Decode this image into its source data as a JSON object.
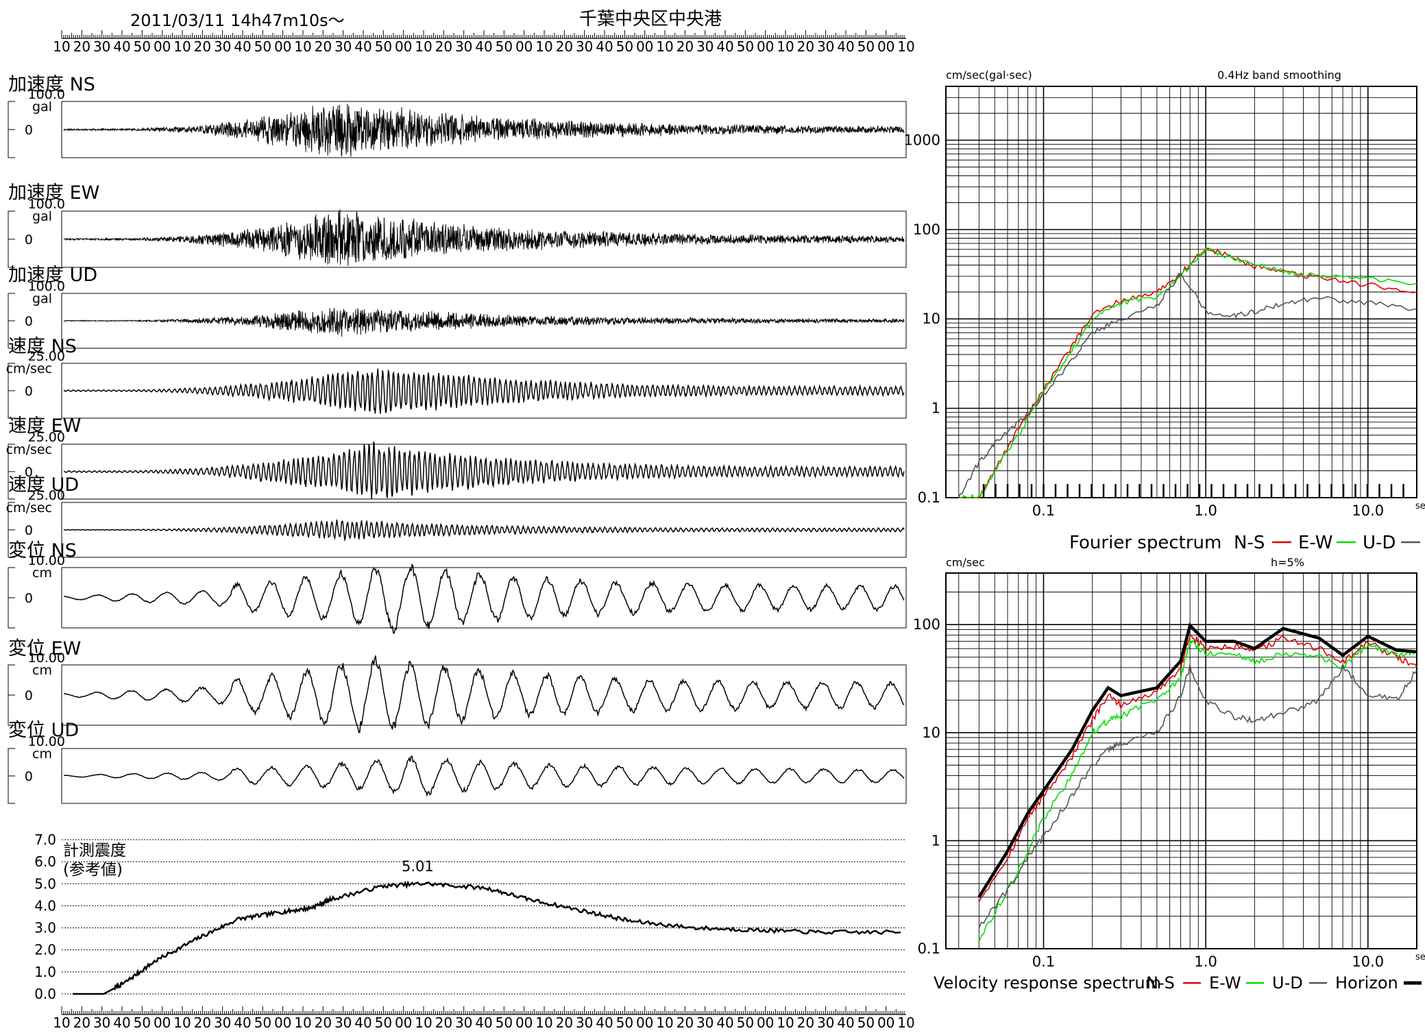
{
  "header": {
    "datetime": "2011/03/11  14h47m10s〜",
    "station": "千葉中央区中央港"
  },
  "time_axis": {
    "tick_labels": [
      "10",
      "20",
      "30",
      "40",
      "50",
      "00",
      "10",
      "20",
      "30",
      "40",
      "50",
      "00",
      "10",
      "20",
      "30",
      "40",
      "50",
      "00",
      "10",
      "20",
      "30",
      "40",
      "50",
      "00",
      "10",
      "20",
      "30",
      "40",
      "50",
      "00",
      "10",
      "20",
      "30",
      "40",
      "50",
      "00",
      "10",
      "20",
      "30",
      "40",
      "50",
      "00",
      "10"
    ],
    "small_marks": [
      "h",
      "m",
      "s"
    ]
  },
  "traces": [
    {
      "label": "加速度 NS",
      "scale": "100.0",
      "unit": "gal",
      "zero": "0",
      "kind": "acc",
      "amp": 1.0,
      "env_peak": 0.33,
      "seed": 11
    },
    {
      "label": "加速度 EW",
      "scale": "100.0",
      "unit": "gal",
      "zero": "0",
      "kind": "acc",
      "amp": 1.0,
      "env_peak": 0.33,
      "seed": 23
    },
    {
      "label": "加速度 UD",
      "scale": "100.0",
      "unit": "gal",
      "zero": "0",
      "kind": "acc",
      "amp": 0.55,
      "env_peak": 0.33,
      "seed": 37
    },
    {
      "label": "速度 NS",
      "scale": "25.00",
      "unit": "cm/sec",
      "zero": "0",
      "kind": "vel",
      "amp": 0.85,
      "env_peak": 0.38,
      "seed": 41
    },
    {
      "label": "速度 EW",
      "scale": "25.00",
      "unit": "cm/sec",
      "zero": "0",
      "kind": "vel",
      "amp": 0.95,
      "env_peak": 0.37,
      "seed": 53
    },
    {
      "label": "速度 UD",
      "scale": "25.00",
      "unit": "cm/sec",
      "zero": "0",
      "kind": "vel",
      "amp": 0.35,
      "env_peak": 0.33,
      "seed": 61
    },
    {
      "label": "変位 NS",
      "scale": "10.00",
      "unit": "cm",
      "zero": "0",
      "kind": "disp",
      "amp": 0.9,
      "env_peak": 0.4,
      "seed": 71
    },
    {
      "label": "変位 EW",
      "scale": "10.00",
      "unit": "cm",
      "zero": "0",
      "kind": "disp",
      "amp": 1.0,
      "env_peak": 0.37,
      "seed": 83
    },
    {
      "label": "変位 UD",
      "scale": "10.00",
      "unit": "cm",
      "zero": "0",
      "kind": "disp",
      "amp": 0.55,
      "env_peak": 0.42,
      "seed": 97
    }
  ],
  "intensity": {
    "title_line1": "計測震度",
    "title_line2": "(参考値)",
    "max_label": "5.01",
    "yticks": [
      "7.0",
      "6.0",
      "5.0",
      "4.0",
      "3.0",
      "2.0",
      "1.0",
      "0.0"
    ]
  },
  "fourier": {
    "unit": "cm/sec(gal·sec)",
    "note": "0.4Hz band smoothing",
    "caption": "Fourier spectrum",
    "legend": [
      {
        "name": "N-S",
        "color": "#e00000"
      },
      {
        "name": "E-W",
        "color": "#00dd00"
      },
      {
        "name": "U-D",
        "color": "#555555"
      }
    ]
  },
  "response": {
    "unit": "cm/sec",
    "note": "h=5%",
    "caption": "Velocity response spectrum",
    "legend": [
      {
        "name": "N-S",
        "color": "#e00000"
      },
      {
        "name": "E-W",
        "color": "#00dd00"
      },
      {
        "name": "U-D",
        "color": "#555555"
      },
      {
        "name": "Horizon",
        "color": "#000000"
      }
    ]
  },
  "spectrum_axes": {
    "x_ticks": [
      "0.1",
      "1.0",
      "10.0"
    ],
    "x_unit": "sec",
    "fourier_y_ticks": [
      "1000",
      "100",
      "10",
      "1",
      "0.1"
    ],
    "response_y_ticks": [
      "100",
      "10",
      "1",
      "0.1"
    ]
  },
  "chart_data": [
    {
      "type": "line",
      "title": "Fourier spectrum",
      "note": "0.4Hz band smoothing",
      "ylabel": "cm/sec(gal·sec)",
      "xlabel": "sec",
      "x_scale": "log",
      "y_scale": "log",
      "xlim": [
        0.025,
        20
      ],
      "ylim": [
        0.1,
        4000
      ],
      "x": [
        0.03,
        0.04,
        0.05,
        0.07,
        0.1,
        0.15,
        0.2,
        0.3,
        0.5,
        0.7,
        1.0,
        1.5,
        2.0,
        3.0,
        5.0,
        10.0,
        20.0
      ],
      "series": [
        {
          "name": "N-S",
          "values": [
            0.1,
            0.1,
            0.2,
            0.6,
            1.6,
            5.0,
            11.0,
            16.0,
            20.0,
            32.0,
            62.0,
            48.0,
            38.0,
            33.0,
            29.0,
            24.0,
            20.0
          ]
        },
        {
          "name": "E-W",
          "values": [
            0.1,
            0.1,
            0.2,
            0.5,
            1.5,
            4.5,
            10.0,
            15.0,
            18.0,
            30.0,
            60.0,
            48.0,
            40.0,
            34.0,
            31.0,
            28.0,
            25.0
          ]
        },
        {
          "name": "U-D",
          "values": [
            0.1,
            0.25,
            0.4,
            0.7,
            1.4,
            3.5,
            7.0,
            10.0,
            14.0,
            33.0,
            12.0,
            11.0,
            12.0,
            15.0,
            17.0,
            15.0,
            13.0
          ]
        }
      ]
    },
    {
      "type": "line",
      "title": "Velocity response spectrum",
      "note": "h=5%",
      "ylabel": "cm/sec",
      "xlabel": "sec",
      "x_scale": "log",
      "y_scale": "log",
      "xlim": [
        0.025,
        20
      ],
      "ylim": [
        0.1,
        300
      ],
      "x": [
        0.04,
        0.06,
        0.08,
        0.1,
        0.15,
        0.2,
        0.25,
        0.3,
        0.5,
        0.7,
        0.8,
        1.0,
        1.5,
        2.0,
        3.0,
        5.0,
        7.0,
        10.0,
        15.0,
        20.0
      ],
      "series": [
        {
          "name": "N-S",
          "values": [
            0.28,
            0.7,
            1.6,
            2.6,
            6.0,
            13.0,
            22.0,
            18.0,
            24.0,
            40.0,
            80.0,
            60.0,
            62.0,
            56.0,
            75.0,
            60.0,
            45.0,
            68.0,
            50.0,
            40.0
          ]
        },
        {
          "name": "E-W",
          "values": [
            0.12,
            0.35,
            0.8,
            1.6,
            4.0,
            10.0,
            13.0,
            14.0,
            21.0,
            32.0,
            70.0,
            55.0,
            52.0,
            45.0,
            55.0,
            50.0,
            40.0,
            65.0,
            52.0,
            55.0
          ]
        },
        {
          "name": "U-D",
          "values": [
            0.16,
            0.35,
            0.7,
            1.1,
            2.6,
            5.0,
            7.0,
            8.0,
            10.0,
            22.0,
            40.0,
            20.0,
            14.0,
            13.0,
            15.0,
            20.0,
            40.0,
            22.0,
            20.0,
            38.0
          ]
        },
        {
          "name": "Horizon",
          "values": [
            0.3,
            0.8,
            1.8,
            2.9,
            7.0,
            16.0,
            26.0,
            22.0,
            26.0,
            46.0,
            98.0,
            70.0,
            70.0,
            60.0,
            92.0,
            75.0,
            52.0,
            78.0,
            58.0,
            56.0
          ]
        }
      ]
    },
    {
      "type": "line",
      "title": "計測震度",
      "ylim": [
        0,
        7
      ],
      "x": [
        0,
        1.5,
        2.5,
        4,
        6,
        8,
        10,
        11.5,
        12.5,
        15,
        17,
        20,
        22,
        25,
        27,
        30,
        33,
        36,
        40
      ],
      "values": [
        0.0,
        0.0,
        0.5,
        1.5,
        2.5,
        3.4,
        3.7,
        3.9,
        4.3,
        4.9,
        5.01,
        4.8,
        4.3,
        3.7,
        3.3,
        3.0,
        2.9,
        2.8,
        2.8
      ],
      "max_label": "5.01"
    }
  ]
}
